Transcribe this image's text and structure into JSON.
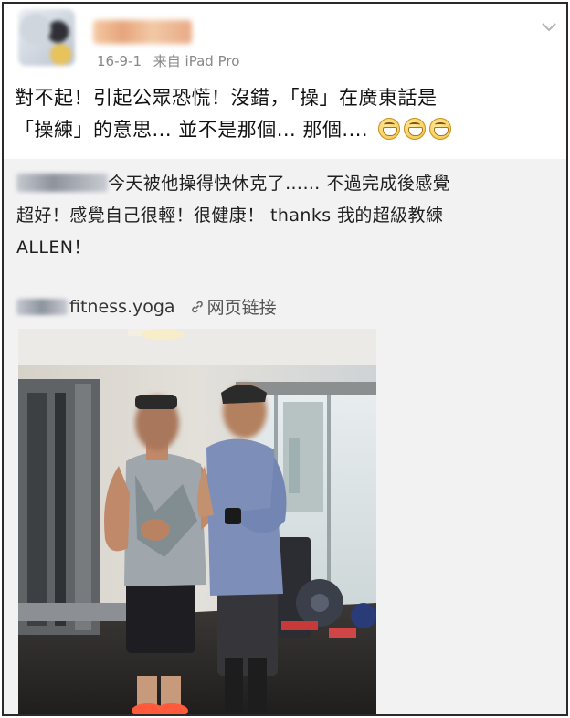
{
  "post": {
    "author_name": "",
    "date": "16-9-1",
    "source": "来自 iPad Pro",
    "text_line1": "對不起！引起公眾恐慌！沒錯，「操」在廣東話是",
    "text_line2": "「操練」的意思... 並不是那個... 那個....",
    "emoji_icons": [
      "grin-emoji",
      "grin-emoji",
      "grin-emoji"
    ]
  },
  "quote": {
    "text_line1": "今天被他操得快休克了…… 不過完成後感覺",
    "text_line2": "超好！感覺自己很輕！很健康！ thanks 我的超級教練",
    "text_line3": "ALLEN！",
    "link_suffix": "fitness.yoga",
    "web_link_label": "网页链接",
    "link_icon": "link-icon"
  },
  "colors": {
    "meta_gray": "#888888",
    "quote_background": "#f2f2f3",
    "frame_border": "#2a2a2a"
  }
}
